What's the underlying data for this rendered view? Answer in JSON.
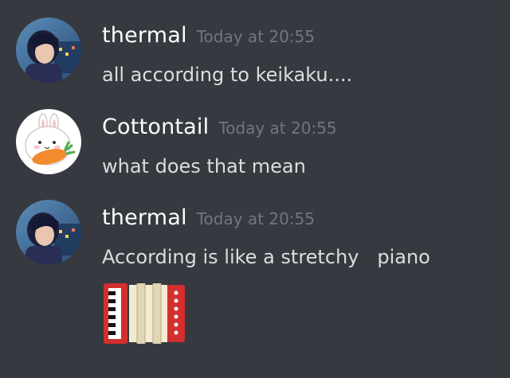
{
  "messages": [
    {
      "username": "thermal",
      "timestamp": "Today at 20:55",
      "text": "all according to keikaku....",
      "avatar_icon": "anime-character-avatar"
    },
    {
      "username": "Cottontail",
      "timestamp": "Today at 20:55",
      "text": "what does that mean",
      "avatar_icon": "bunny-with-carrot-avatar"
    },
    {
      "username": "thermal",
      "timestamp": "Today at 20:55",
      "text": "According is like a stretchy   piano",
      "avatar_icon": "anime-character-avatar",
      "emoji": "accordion-emoji"
    }
  ],
  "colors": {
    "background": "#36393f",
    "username": "#ffffff",
    "timestamp": "#72767d",
    "message_text": "#dcddde",
    "accordion_red": "#d32f2f",
    "accordion_cream": "#f3ead2"
  }
}
